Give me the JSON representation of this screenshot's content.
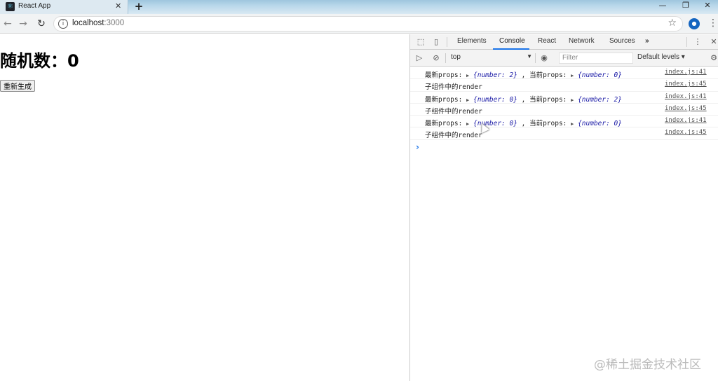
{
  "browser": {
    "tab_title": "React App",
    "url_host": "localhost",
    "url_port": ":3000"
  },
  "page": {
    "heading": "随机数：0",
    "button_label": "重新生成"
  },
  "devtools": {
    "tabs": [
      "Elements",
      "Console",
      "React",
      "Network",
      "Sources"
    ],
    "more": "»",
    "context": "top",
    "filter_placeholder": "Filter",
    "levels": "Default levels",
    "logs": [
      {
        "pre": "最新props: ",
        "obj1": "{number: 2}",
        "mid": " , 当前props: ",
        "obj2": "{number: 0}",
        "src": "index.js:41",
        "type": "props"
      },
      {
        "text": "子组件中的render",
        "src": "index.js:45",
        "type": "text"
      },
      {
        "pre": "最新props: ",
        "obj1": "{number: 0}",
        "mid": " , 当前props: ",
        "obj2": "{number: 2}",
        "src": "index.js:41",
        "type": "props"
      },
      {
        "text": "子组件中的render",
        "src": "index.js:45",
        "type": "text"
      },
      {
        "pre": "最新props: ",
        "obj1": "{number: 0}",
        "mid": " , 当前props: ",
        "obj2": "{number: 0}",
        "src": "index.js:41",
        "type": "props"
      },
      {
        "text": "子组件中的render",
        "src": "index.js:45",
        "type": "text"
      }
    ],
    "prompt": "›"
  },
  "watermark": "@稀土掘金技术社区",
  "colors": {
    "accent": "#1a73e8",
    "object_text": "#1a1aa6"
  }
}
